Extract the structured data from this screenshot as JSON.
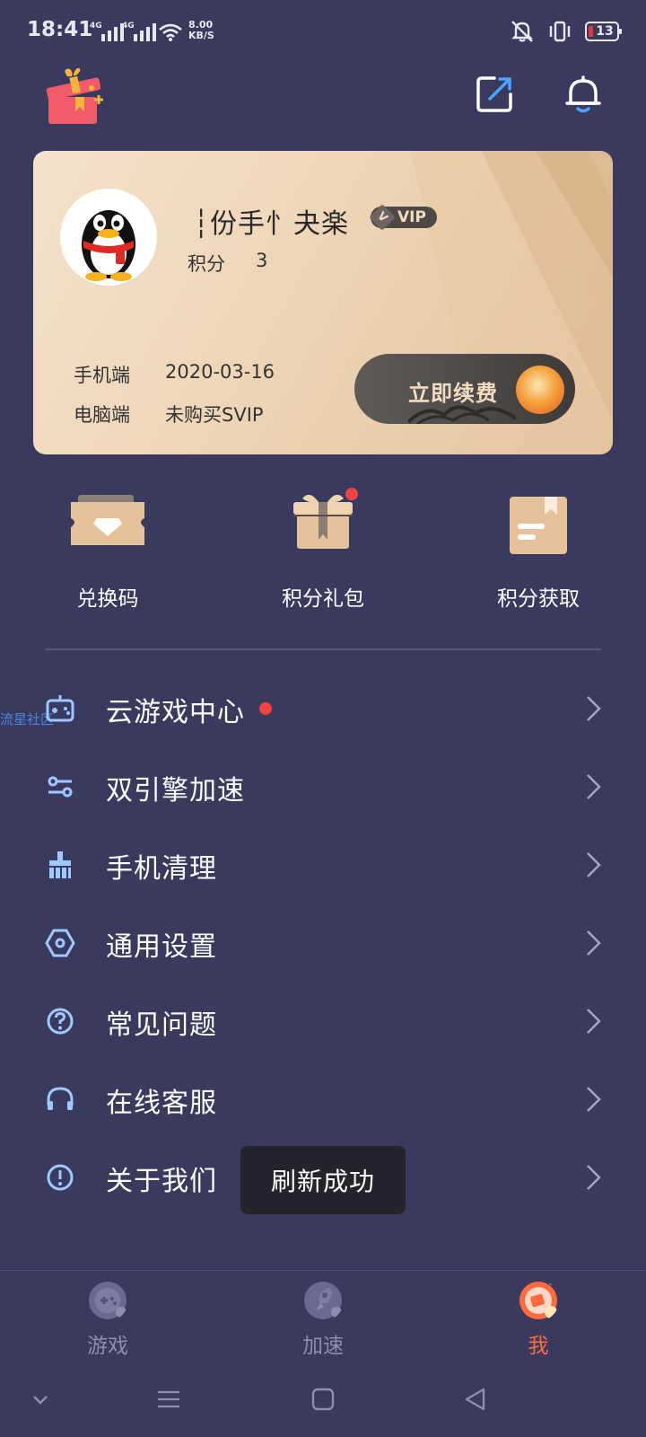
{
  "status_bar": {
    "time": "18:41",
    "signal_1": "4G",
    "signal_2": "4G",
    "net_speed_value": "8.00",
    "net_speed_unit": "KB/S",
    "battery": "13"
  },
  "watermark": "流星社区",
  "vip_card": {
    "user_name": "┆份手忄夬楽",
    "vip_badge": "VIP",
    "points_label": "积分",
    "points_value": "3",
    "mobile_label": "手机端",
    "mobile_value": "2020-03-16",
    "pc_label": "电脑端",
    "pc_value": "未购买SVIP",
    "renew_label": "立即续费"
  },
  "quick_actions": [
    {
      "label": "兑换码"
    },
    {
      "label": "积分礼包"
    },
    {
      "label": "积分获取"
    }
  ],
  "menu": [
    {
      "label": "云游戏中心",
      "icon": "gamepad-icon"
    },
    {
      "label": "双引擎加速",
      "icon": "engine-icon"
    },
    {
      "label": "手机清理",
      "icon": "broom-icon"
    },
    {
      "label": "通用设置",
      "icon": "settings-icon"
    },
    {
      "label": "常见问题",
      "icon": "question-icon"
    },
    {
      "label": "在线客服",
      "icon": "headset-icon"
    },
    {
      "label": "关于我们",
      "icon": "info-icon"
    }
  ],
  "toast": "刷新成功",
  "bottom_nav": [
    {
      "label": "游戏"
    },
    {
      "label": "加速"
    },
    {
      "label": "我",
      "active": true
    }
  ],
  "colors": {
    "background": "#3a3a5f",
    "accent": "#ff6a3d",
    "menu_icon": "#9ec8ff",
    "red_dot": "#f04444"
  }
}
